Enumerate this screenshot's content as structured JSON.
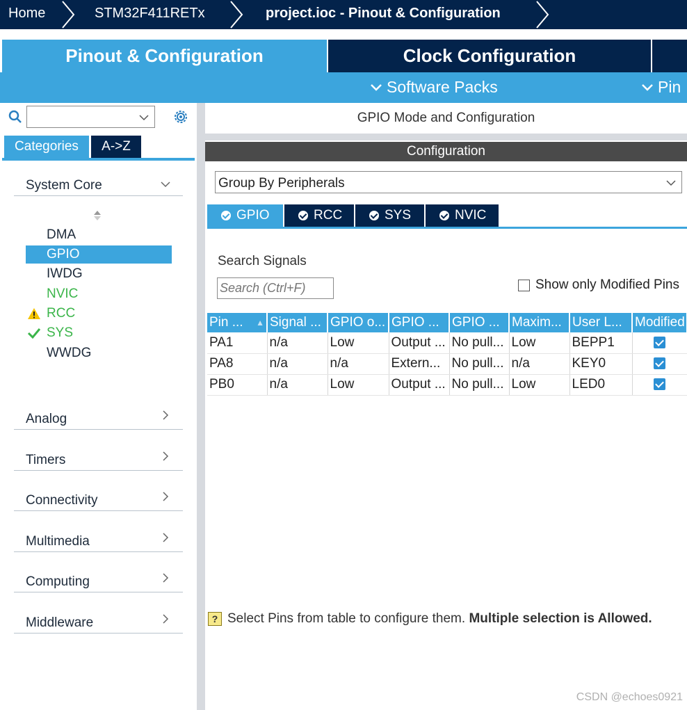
{
  "breadcrumb": {
    "home": "Home",
    "device": "STM32F411RETx",
    "project": "project.ioc - Pinout & Configuration"
  },
  "tabs": {
    "pinout": "Pinout & Configuration",
    "clock": "Clock Configuration"
  },
  "subtabs": {
    "software_packs": "Software Packs",
    "pinout": "Pin"
  },
  "sidebar": {
    "search_value": "",
    "tab_categories": "Categories",
    "tab_az": "A->Z",
    "system_core": "System Core",
    "items": [
      {
        "label": "DMA",
        "status": "none"
      },
      {
        "label": "GPIO",
        "status": "selected"
      },
      {
        "label": "IWDG",
        "status": "none"
      },
      {
        "label": "NVIC",
        "status": "ok"
      },
      {
        "label": "RCC",
        "status": "warning"
      },
      {
        "label": "SYS",
        "status": "ok"
      },
      {
        "label": "WWDG",
        "status": "none"
      }
    ],
    "categories": [
      "Analog",
      "Timers",
      "Connectivity",
      "Multimedia",
      "Computing",
      "Middleware"
    ]
  },
  "main": {
    "title": "GPIO Mode and Configuration",
    "config_header": "Configuration",
    "group_by": "Group By Peripherals",
    "peripheral_tabs": [
      "GPIO",
      "RCC",
      "SYS",
      "NVIC"
    ],
    "search_label": "Search Signals",
    "search_placeholder": "Search (Ctrl+F)",
    "show_modified_label": "Show only Modified Pins",
    "columns": [
      "Pin ...",
      "Signal ...",
      "GPIO o...",
      "GPIO ...",
      "GPIO ...",
      "Maxim...",
      "User L...",
      "Modified"
    ],
    "rows": [
      {
        "pin": "PA1",
        "signal": "n/a",
        "output": "Low",
        "mode": "Output ...",
        "pull": "No pull...",
        "speed": "Low",
        "label": "BEPP1",
        "modified": true
      },
      {
        "pin": "PA8",
        "signal": "n/a",
        "output": "n/a",
        "mode": "Extern...",
        "pull": "No pull...",
        "speed": "n/a",
        "label": "KEY0",
        "modified": true
      },
      {
        "pin": "PB0",
        "signal": "n/a",
        "output": "Low",
        "mode": "Output ...",
        "pull": "No pull...",
        "speed": "Low",
        "label": "LED0",
        "modified": true
      }
    ],
    "hint_normal": "Select Pins from table to configure them. ",
    "hint_bold": "Multiple selection is Allowed."
  },
  "watermark": "CSDN @echoes0921",
  "colors": {
    "navy": "#03234b",
    "accent": "#3ca5dd",
    "ok_green": "#3bb54a",
    "warning": "#f5c400"
  }
}
